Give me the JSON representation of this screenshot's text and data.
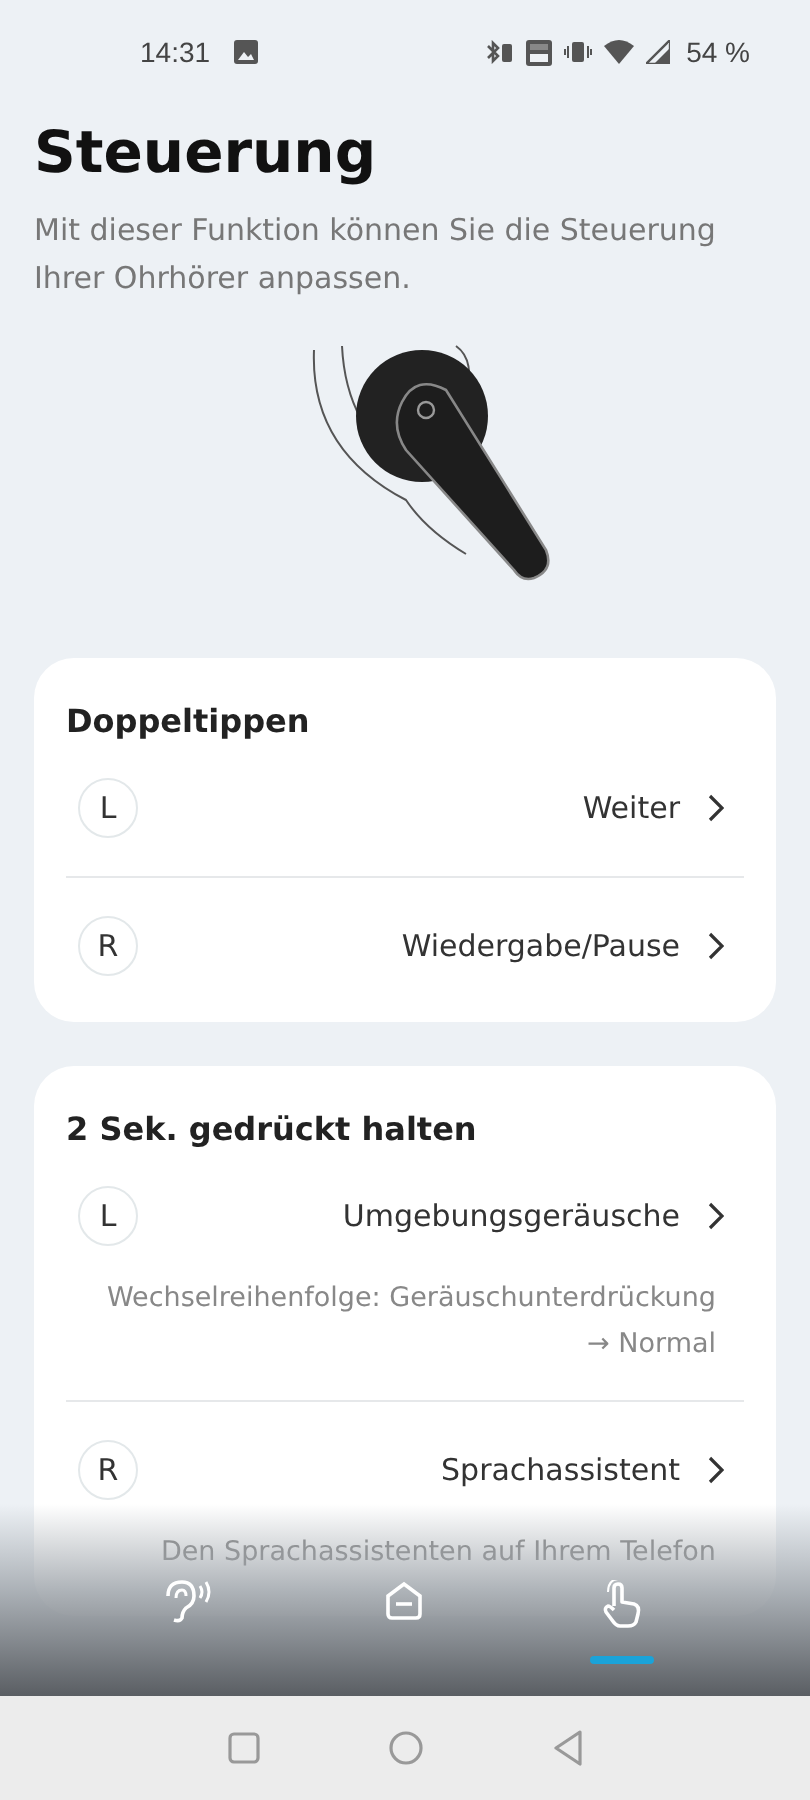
{
  "status_bar": {
    "time": "14:31",
    "battery": "54 %"
  },
  "header": {
    "title": "Steuerung",
    "subtitle": "Mit dieser Funktion können Sie die Steuerung Ihrer Ohrhörer anpassen."
  },
  "sections": [
    {
      "title": "Doppeltippen",
      "rows": [
        {
          "side": "L",
          "action": "Weiter"
        },
        {
          "side": "R",
          "action": "Wiedergabe/Pause"
        }
      ]
    },
    {
      "title": "2 Sek. gedrückt halten",
      "rows": [
        {
          "side": "L",
          "action": "Umgebungsgeräusche",
          "note": "Wechselreihenfolge: Geräuschunterdrückung → Normal"
        },
        {
          "side": "R",
          "action": "Sprachassistent",
          "note": "Den Sprachassistenten auf Ihrem Telefon"
        }
      ]
    }
  ],
  "bottom_nav": [
    {
      "kind": "ear",
      "selected": false
    },
    {
      "kind": "home",
      "selected": false
    },
    {
      "kind": "touch",
      "selected": true
    }
  ]
}
